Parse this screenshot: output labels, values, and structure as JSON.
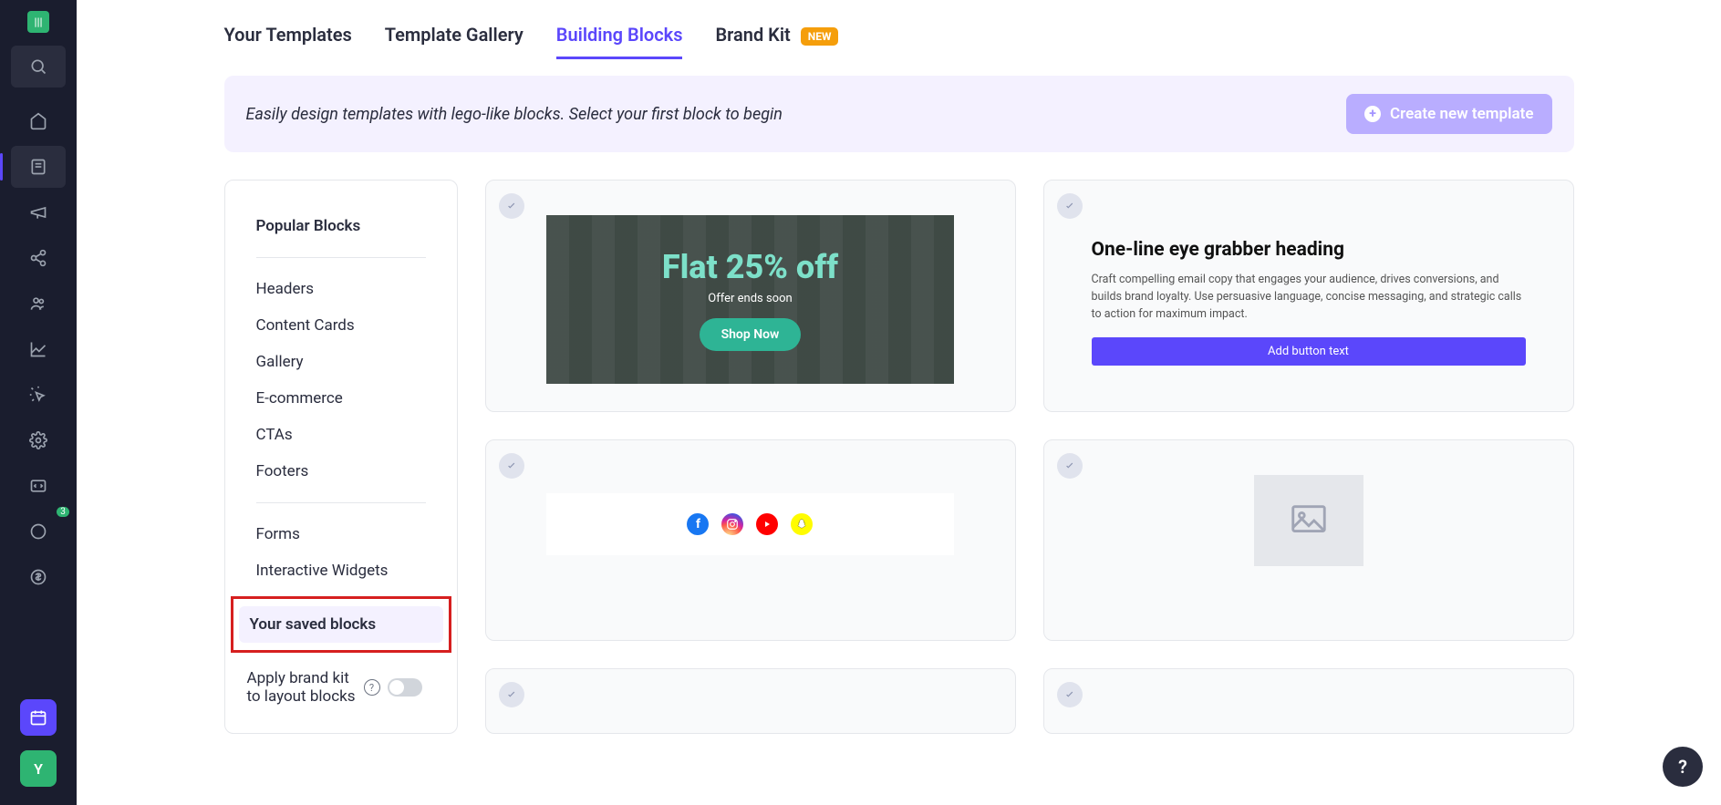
{
  "rail": {
    "notification_count": "3",
    "avatar_initial": "Y"
  },
  "tabs": [
    {
      "label": "Your Templates",
      "active": false
    },
    {
      "label": "Template Gallery",
      "active": false
    },
    {
      "label": "Building Blocks",
      "active": true
    },
    {
      "label": "Brand Kit",
      "active": false,
      "badge": "NEW"
    }
  ],
  "banner": {
    "text": "Easily design templates with lego-like blocks. Select your first block to begin",
    "button": "Create new template"
  },
  "sidebar": {
    "popular": "Popular Blocks",
    "items1": [
      "Headers",
      "Content Cards",
      "Gallery",
      "E-commerce",
      "CTAs",
      "Footers"
    ],
    "items2": [
      "Forms",
      "Interactive Widgets"
    ],
    "saved": "Your saved blocks",
    "brand_kit": "Apply brand kit to layout blocks"
  },
  "blocks": {
    "promo": {
      "title": "Flat 25% off",
      "subtitle": "Offer ends soon",
      "button": "Shop Now"
    },
    "text": {
      "heading": "One-line eye grabber heading",
      "body": "Craft compelling email copy that engages your audience, drives conversions, and builds brand loyalty. Use persuasive language, concise messaging, and strategic calls to action for maximum impact.",
      "button": "Add button text"
    }
  }
}
